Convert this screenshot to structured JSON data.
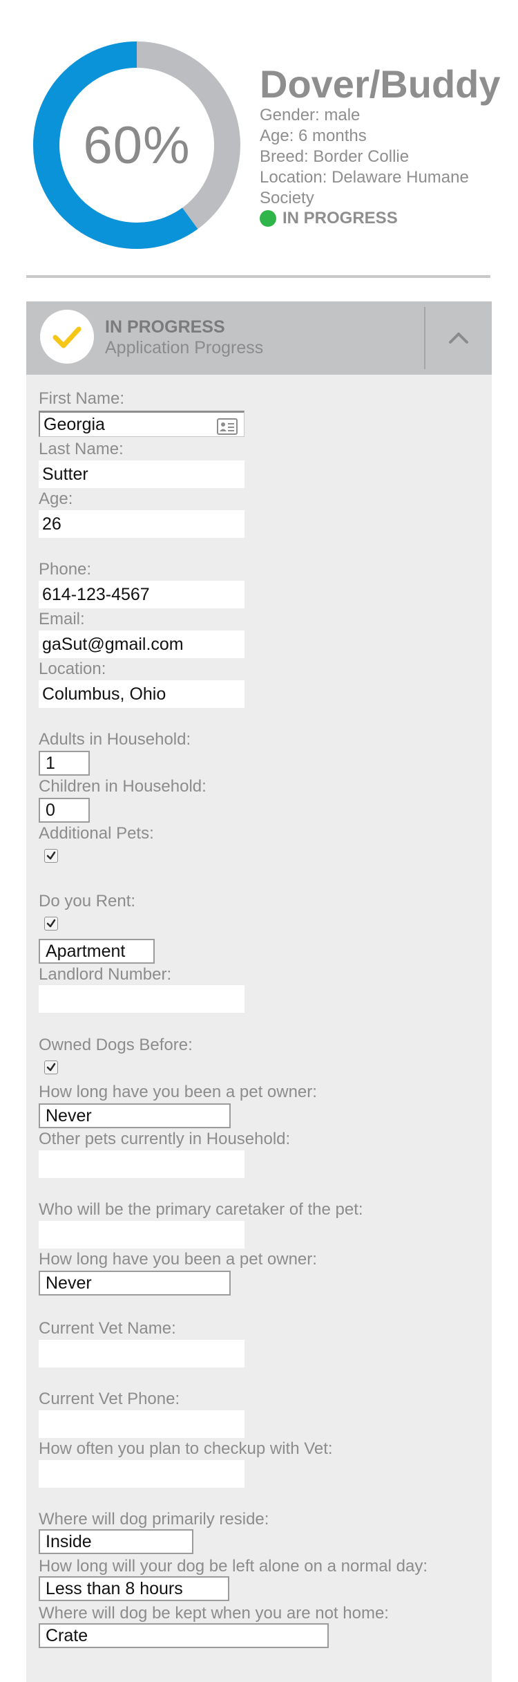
{
  "progress": {
    "percent_label": "60%",
    "value": 0.6,
    "fill_color": "#0a93d9",
    "track_color": "#bcbdc1"
  },
  "pet": {
    "name": "Dover/Buddy",
    "gender": "Gender: male",
    "age": "Age: 6 months",
    "breed": "Breed: Border Collie",
    "location_line1": "Location: Delaware Humane",
    "location_line2": "Society",
    "status": "IN PROGRESS",
    "status_color": "#30b54a"
  },
  "panel": {
    "status": "IN PROGRESS",
    "subtitle": "Application Progress",
    "check_icon": "check-icon",
    "check_color": "#f5c518",
    "collapse_icon": "chevron-up-icon"
  },
  "form": {
    "first_name": {
      "label": "First Name:",
      "value": "Georgia"
    },
    "last_name": {
      "label": "Last Name:",
      "value": "Sutter"
    },
    "age": {
      "label": "Age:",
      "value": "26"
    },
    "phone": {
      "label": "Phone:",
      "value": "614-123-4567"
    },
    "email": {
      "label": "Email:",
      "value": "gaSut@gmail.com"
    },
    "location": {
      "label": "Location:",
      "value": "Columbus, Ohio"
    },
    "adults": {
      "label": "Adults in Household:",
      "value": "1"
    },
    "children": {
      "label": "Children in Household:",
      "value": "0"
    },
    "additional_pets": {
      "label": "Additional Pets:",
      "checked": true
    },
    "rent": {
      "label": "Do you Rent:",
      "checked": true,
      "housing_value": "Apartment"
    },
    "landlord_number": {
      "label": "Landlord Number:",
      "value": ""
    },
    "owned_dogs": {
      "label": "Owned Dogs Before:",
      "checked": true
    },
    "owner_duration_1": {
      "label": "How long have you been a pet owner:",
      "value": "Never"
    },
    "other_pets": {
      "label": "Other pets currently in Household:",
      "value": ""
    },
    "caretaker": {
      "label": "Who will be the primary caretaker of the pet:",
      "value": ""
    },
    "owner_duration_2": {
      "label": "How long have you been a pet owner:",
      "value": "Never"
    },
    "vet_name": {
      "label": "Current Vet Name:",
      "value": ""
    },
    "vet_phone": {
      "label": "Current Vet Phone:",
      "value": ""
    },
    "vet_checkup": {
      "label": "How often you plan to checkup with Vet:",
      "value": ""
    },
    "reside": {
      "label": "Where will dog primarily reside:",
      "value": "Inside"
    },
    "alone": {
      "label": "How long will your dog be left alone on a normal day:",
      "value": "Less than 8 hours"
    },
    "kept": {
      "label": "Where will dog be kept when you are not home:",
      "value": "Crate"
    }
  }
}
